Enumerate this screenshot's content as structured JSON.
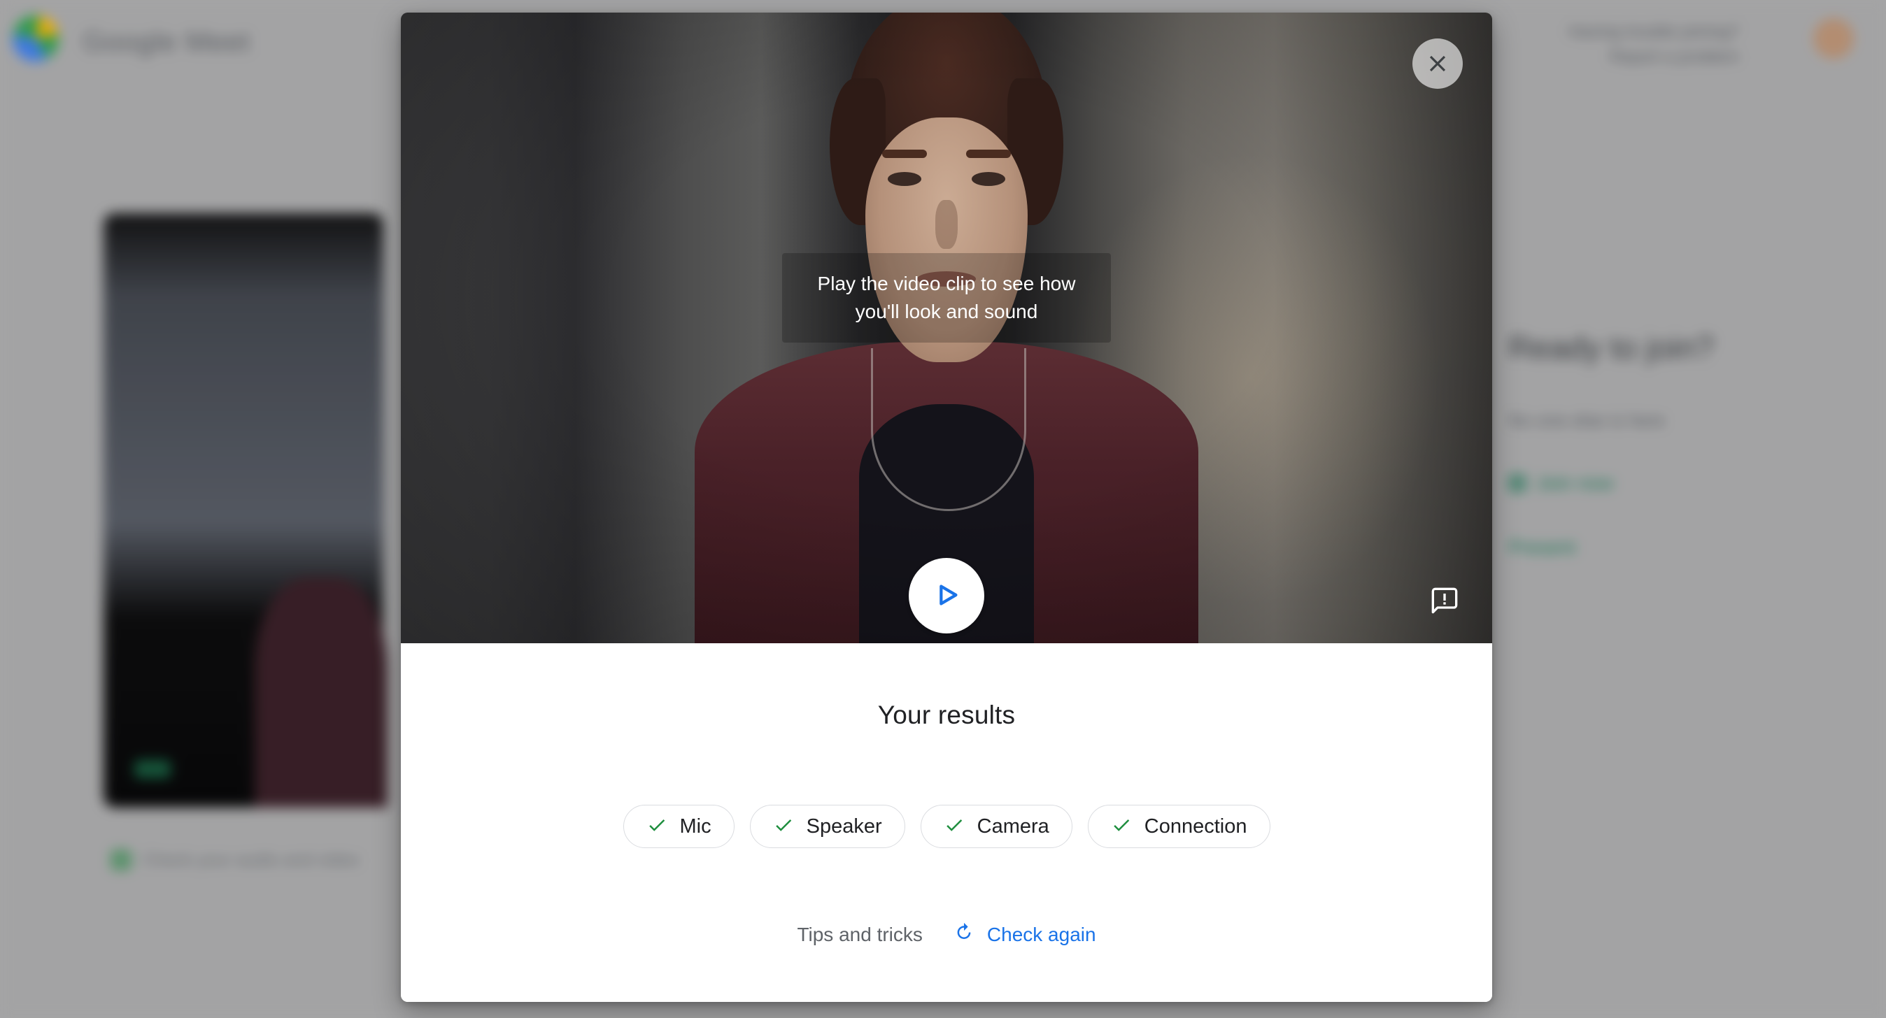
{
  "background": {
    "app_name": "Google Meet",
    "header_right_lines": [
      "Having trouble joining?",
      "Report a problem"
    ],
    "caption_text": "Check your audio and video",
    "right_panel": {
      "heading": "Ready to join?",
      "subtext": "No one else is here",
      "links": [
        "Join now",
        "Present"
      ]
    }
  },
  "modal": {
    "close_label": "Close",
    "video": {
      "hint_text": "Play the video clip to see how you'll look and sound",
      "play_label": "Play",
      "feedback_label": "Send feedback"
    },
    "results": {
      "title": "Your results",
      "chips": [
        {
          "label": "Mic",
          "status": "ok"
        },
        {
          "label": "Speaker",
          "status": "ok"
        },
        {
          "label": "Camera",
          "status": "ok"
        },
        {
          "label": "Connection",
          "status": "ok"
        }
      ],
      "tips_label": "Tips and tricks",
      "check_again_label": "Check again"
    }
  },
  "colors": {
    "accent_blue": "#1a73e8",
    "success_green": "#1e8e3e",
    "text_primary": "#202124",
    "text_secondary": "#5f6368",
    "border": "#dadce0"
  }
}
